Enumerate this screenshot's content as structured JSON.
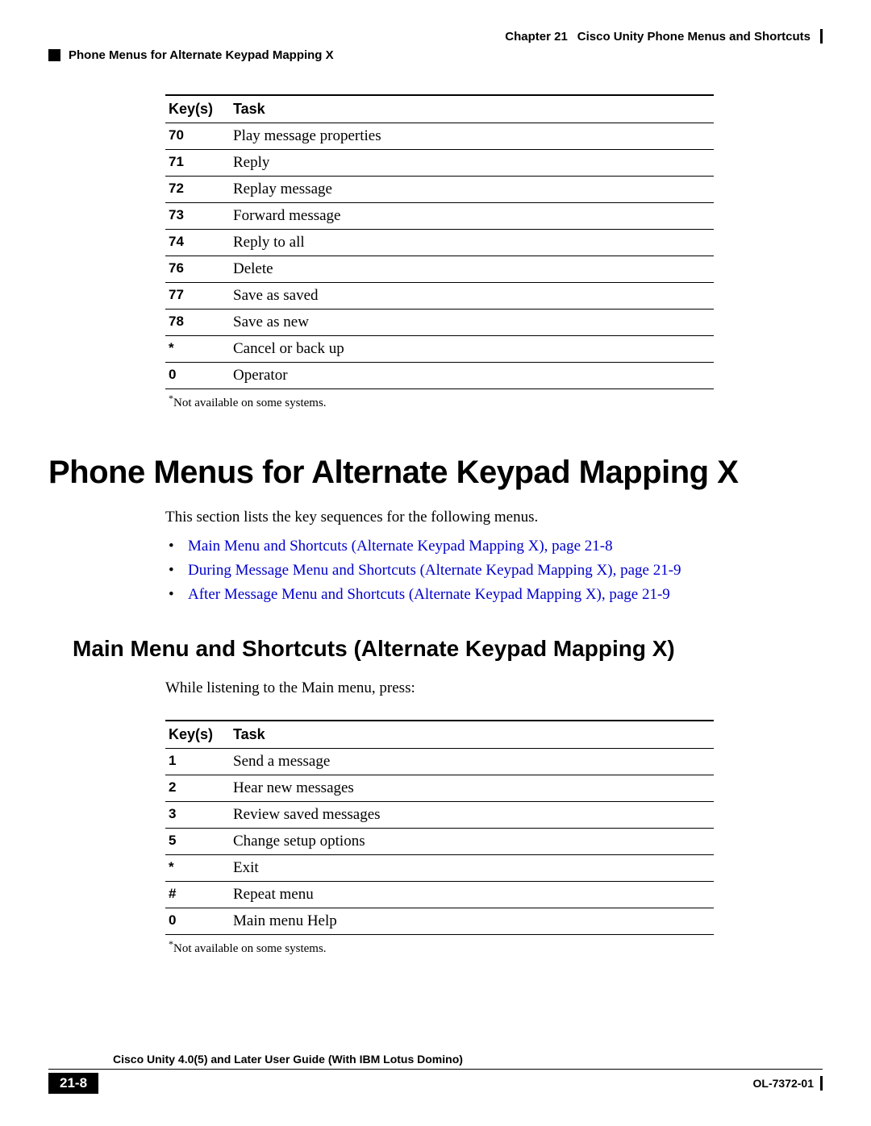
{
  "header": {
    "chapter": "Chapter 21",
    "title": "Cisco Unity Phone Menus and Shortcuts",
    "subtitle": "Phone Menus for Alternate Keypad Mapping X"
  },
  "table1": {
    "col_keys": "Key(s)",
    "col_task": "Task",
    "rows": [
      {
        "key": "70",
        "task": "Play message properties"
      },
      {
        "key": "71",
        "task": "Reply"
      },
      {
        "key": "72",
        "task": "Replay message"
      },
      {
        "key": "73",
        "task": "Forward message"
      },
      {
        "key": "74",
        "task": "Reply to all"
      },
      {
        "key": "76",
        "task": "Delete"
      },
      {
        "key": "77",
        "task": "Save as saved"
      },
      {
        "key": "78",
        "task": "Save as new"
      },
      {
        "key": "*",
        "task": "Cancel or back up"
      },
      {
        "key": "0",
        "task": "Operator"
      }
    ],
    "footnote": "Not available on some systems."
  },
  "section": {
    "heading": "Phone Menus for Alternate Keypad Mapping X",
    "intro": "This section lists the key sequences for the following menus.",
    "links": [
      "Main Menu and Shortcuts (Alternate Keypad Mapping X), page 21-8",
      "During Message Menu and Shortcuts (Alternate Keypad Mapping X), page 21-9",
      "After Message Menu and Shortcuts (Alternate Keypad Mapping X), page 21-9"
    ]
  },
  "subsection": {
    "heading": "Main Menu and Shortcuts (Alternate Keypad Mapping X)",
    "intro": "While listening to the Main menu, press:"
  },
  "table2": {
    "col_keys": "Key(s)",
    "col_task": "Task",
    "rows": [
      {
        "key": "1",
        "task": "Send a message"
      },
      {
        "key": "2",
        "task": "Hear new messages"
      },
      {
        "key": "3",
        "task": "Review saved messages"
      },
      {
        "key": "5",
        "task": "Change setup options"
      },
      {
        "key": "*",
        "task": "Exit"
      },
      {
        "key": "#",
        "task": "Repeat menu"
      },
      {
        "key": "0",
        "task": "Main menu Help"
      }
    ],
    "footnote": "Not available on some systems."
  },
  "footer": {
    "guide": "Cisco Unity 4.0(5) and Later User Guide (With IBM Lotus Domino)",
    "page": "21-8",
    "docnum": "OL-7372-01"
  }
}
